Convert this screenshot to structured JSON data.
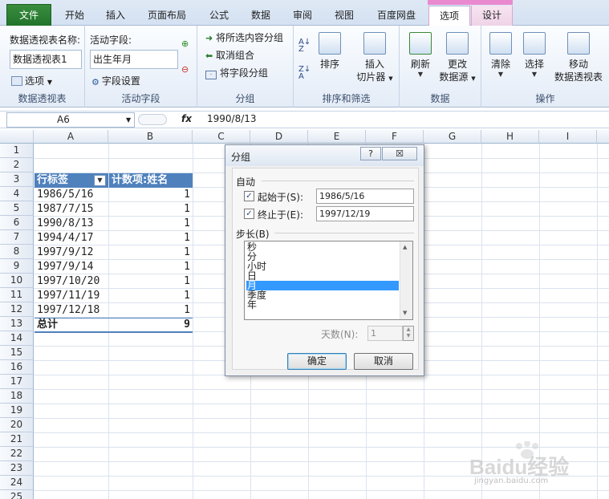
{
  "tabs": [
    {
      "label": "文件"
    },
    {
      "label": "开始"
    },
    {
      "label": "插入"
    },
    {
      "label": "页面布局"
    },
    {
      "label": "公式"
    },
    {
      "label": "数据"
    },
    {
      "label": "审阅"
    },
    {
      "label": "视图"
    },
    {
      "label": "百度网盘"
    },
    {
      "label": "选项"
    },
    {
      "label": "设计"
    }
  ],
  "ribbon": {
    "pivot": {
      "name_label": "数据透视表名称:",
      "name_value": "数据透视表1",
      "options": "选项",
      "group": "数据透视表"
    },
    "field": {
      "label": "活动字段:",
      "value": "出生年月",
      "settings": "字段设置",
      "group": "活动字段"
    },
    "grouping": {
      "group_selection": "将所选内容分组",
      "ungroup": "取消组合",
      "group_field": "将字段分组",
      "group": "分组"
    },
    "sort": {
      "sort": "排序",
      "insert_slicer_1": "插入",
      "insert_slicer_2": "切片器",
      "group": "排序和筛选"
    },
    "data": {
      "refresh": "刷新",
      "change_1": "更改",
      "change_2": "数据源",
      "group": "数据"
    },
    "actions": {
      "clear": "清除",
      "select": "选择",
      "move_1": "移动",
      "move_2": "数据透视表",
      "group": "操作"
    }
  },
  "formula_bar": {
    "name_box": "A6",
    "fx": "fx",
    "value": "1990/8/13"
  },
  "columns": [
    "A",
    "B",
    "C",
    "D",
    "E",
    "F",
    "G",
    "H",
    "I"
  ],
  "rows": [
    "1",
    "2",
    "3",
    "4",
    "5",
    "6",
    "7",
    "8",
    "9",
    "10",
    "11",
    "12",
    "13",
    "14",
    "15",
    "16",
    "17",
    "18",
    "19",
    "20",
    "21",
    "22",
    "23",
    "24",
    "25"
  ],
  "pivot_table": {
    "header_label": "行标签",
    "header_count": "计数项:姓名",
    "rows": [
      {
        "label": "1986/5/16",
        "count": "1"
      },
      {
        "label": "1987/7/15",
        "count": "1"
      },
      {
        "label": "1990/8/13",
        "count": "1"
      },
      {
        "label": "1994/4/17",
        "count": "1"
      },
      {
        "label": "1997/9/12",
        "count": "1"
      },
      {
        "label": "1997/9/14",
        "count": "1"
      },
      {
        "label": "1997/10/20",
        "count": "1"
      },
      {
        "label": "1997/11/19",
        "count": "1"
      },
      {
        "label": "1997/12/18",
        "count": "1"
      }
    ],
    "total_label": "总计",
    "total_value": "9"
  },
  "dialog": {
    "title": "分组",
    "help": "?",
    "close": "☒",
    "auto_label": "自动",
    "start_label": "起始于(S):",
    "start_value": "1986/5/16",
    "end_label": "终止于(E):",
    "end_value": "1997/12/19",
    "step_label": "步长(B)",
    "step_options": [
      "秒",
      "分",
      "小时",
      "日",
      "月",
      "季度",
      "年"
    ],
    "selected_step": "月",
    "days_label": "天数(N):",
    "days_value": "1",
    "ok": "确定",
    "cancel": "取消"
  },
  "watermark": {
    "brand": "Baidu经验",
    "url": "jingyan.baidu.com"
  },
  "colors": {
    "pivot_header": "#4f81bd",
    "file_tab": "#2a7d31",
    "list_selection": "#3399ff",
    "context_tab": "#e98ad0"
  }
}
